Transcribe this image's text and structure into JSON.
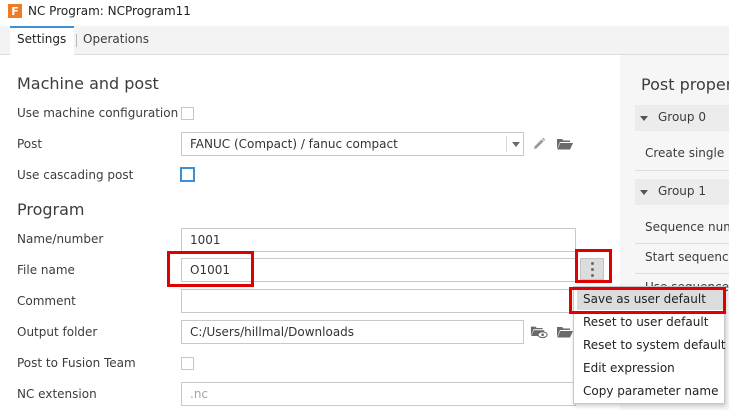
{
  "window": {
    "app_icon_letter": "F",
    "title": "NC Program: NCProgram11"
  },
  "tabs": [
    {
      "label": "Settings",
      "active": true
    },
    {
      "label": "Operations",
      "active": false
    }
  ],
  "machine_and_post": {
    "heading": "Machine and post",
    "use_machine_configuration_label": "Use machine configuration",
    "use_machine_configuration_checked": false,
    "post_label": "Post",
    "post_value": "FANUC (Compact) / fanuc compact",
    "use_cascading_post_label": "Use cascading post",
    "use_cascading_post_checked": false
  },
  "program": {
    "heading": "Program",
    "name_number_label": "Name/number",
    "name_number_value": "1001",
    "file_name_label": "File name",
    "file_name_value": "O1001",
    "comment_label": "Comment",
    "comment_value": "",
    "output_folder_label": "Output folder",
    "output_folder_value": "C:/Users/hillmal/Downloads",
    "post_to_fusion_team_label": "Post to Fusion Team",
    "post_to_fusion_team_checked": false,
    "nc_extension_label": "NC extension",
    "nc_extension_placeholder": ".nc"
  },
  "post_properties": {
    "heading": "Post proper",
    "group0_label": "Group 0",
    "create_single_label": "Create single r",
    "group1_label": "Group 1",
    "sequence_num_label": "Sequence num",
    "start_sequence_label": "Start sequence",
    "use_sequence_label": "Use sequence"
  },
  "context_menu": {
    "items": [
      "Save as user default",
      "Reset to user default",
      "Reset to system default",
      "Edit expression",
      "Copy parameter name"
    ],
    "highlighted_index": 0
  },
  "colors": {
    "accent": "#3a8fd6",
    "annotation_red": "#e00000",
    "app_icon": "#f07b22"
  },
  "icons": {
    "edit": "pencil-icon",
    "folder": "folder-icon",
    "folder_view": "folder-eye-icon",
    "more": "vertical-ellipsis-icon"
  }
}
